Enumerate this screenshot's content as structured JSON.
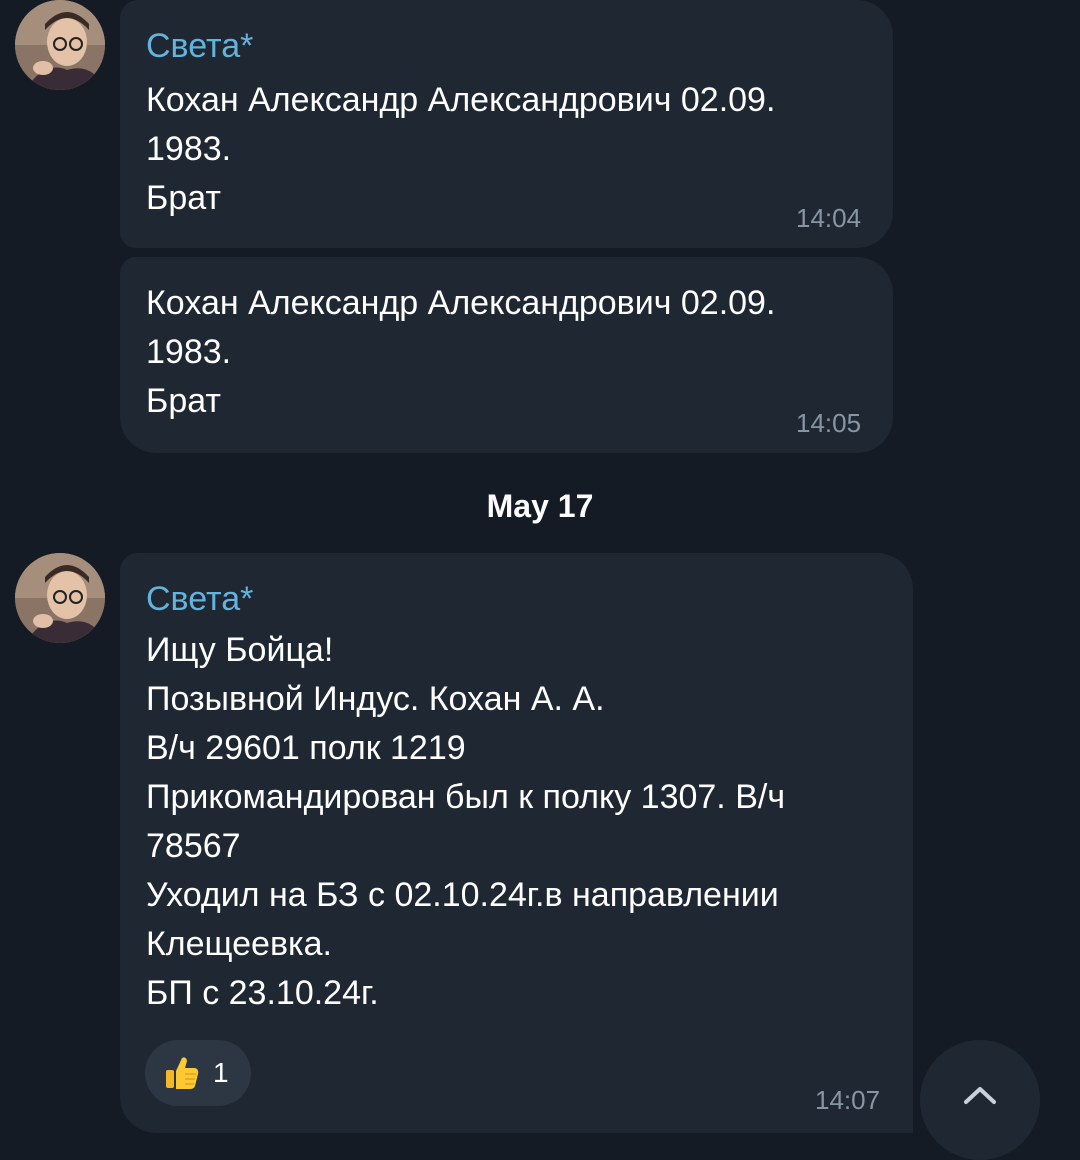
{
  "messages": [
    {
      "sender": "Света*",
      "lines": [
        "Кохан Александр Александрович  02.09.",
        "1983.",
        "Брат"
      ],
      "time": "14:04"
    },
    {
      "lines": [
        "Кохан Александр Александрович  02.09.",
        "1983.",
        "Брат"
      ],
      "time": "14:05"
    },
    {
      "sender": "Света*",
      "lines": [
        "Ищу Бойца!",
        "Позывной Индус. Кохан А. А.",
        "В/ч 29601 полк 1219",
        "Прикомандирован был к полку 1307. В/ч",
        "78567",
        "Уходил на БЗ с 02.10.24г.в направлении",
        "Клещеевка.",
        "БП с 23.10.24г."
      ],
      "reaction": {
        "icon": "thumbs-up-icon",
        "count": "1"
      },
      "time": "14:07"
    }
  ],
  "date_separator": "May 17",
  "scroll_button_icon": "chevron-up-icon",
  "colors": {
    "background": "#151b24",
    "bubble": "#1f2733",
    "sender_name": "#64b3dc",
    "time": "#8895a3",
    "reaction_bg": "#2d3744"
  }
}
